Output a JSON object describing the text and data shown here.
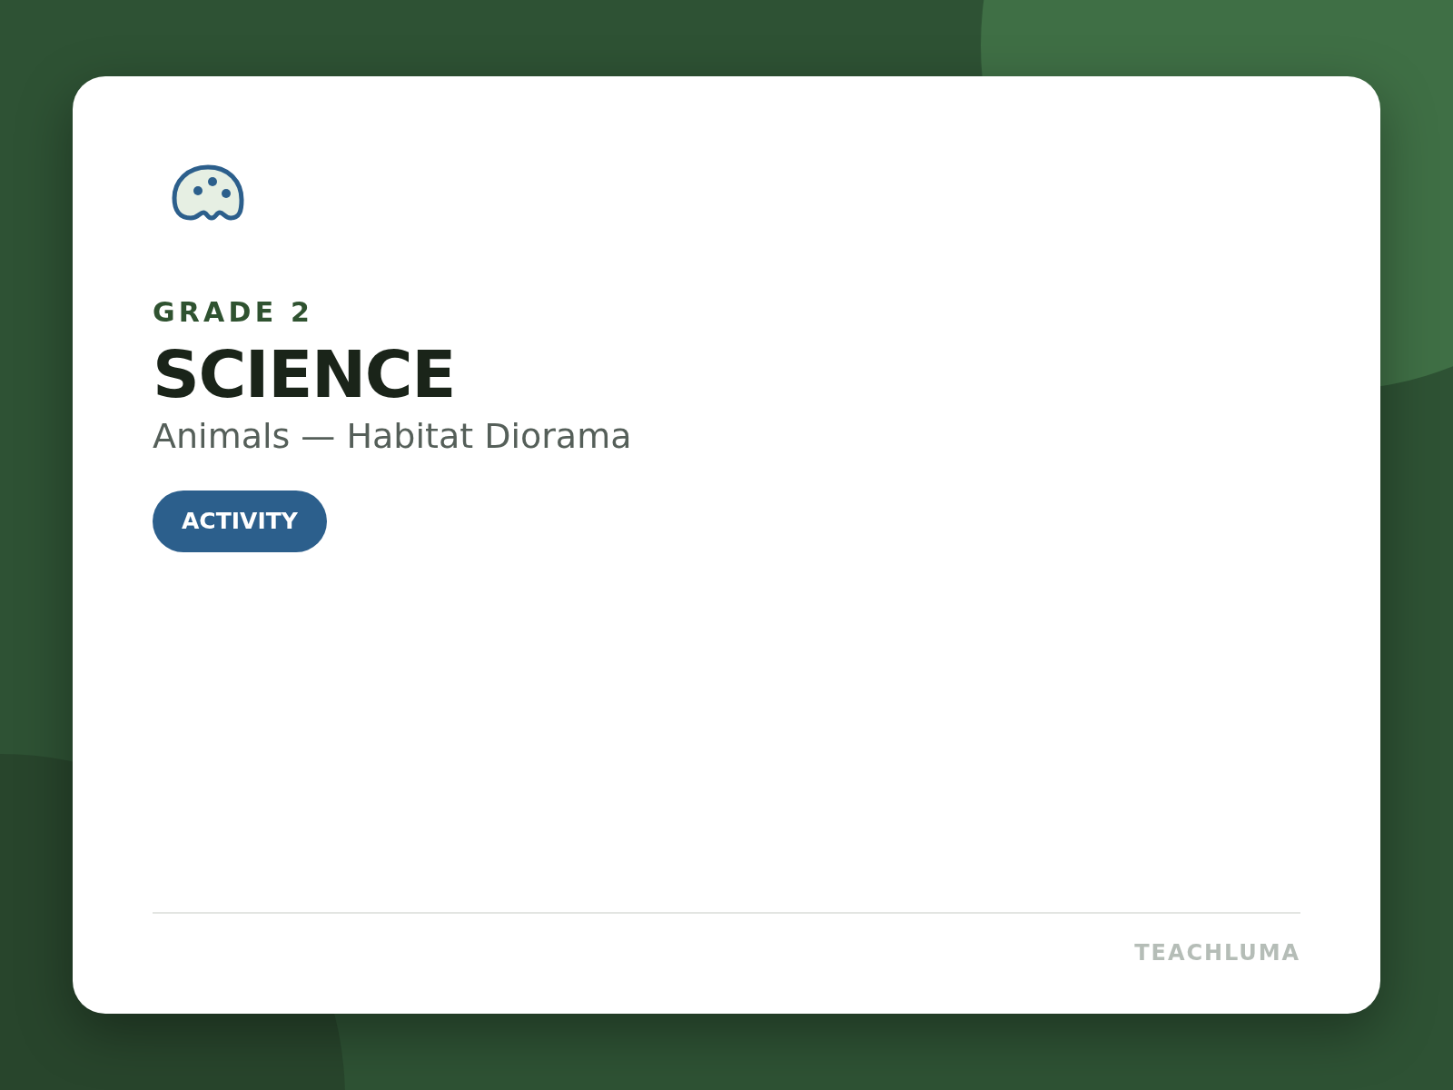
{
  "card": {
    "grade": "GRADE 2",
    "subject": "SCIENCE",
    "topic": "Animals — Habitat Diorama",
    "tag": "ACTIVITY",
    "brand": "TEACHLUMA"
  }
}
